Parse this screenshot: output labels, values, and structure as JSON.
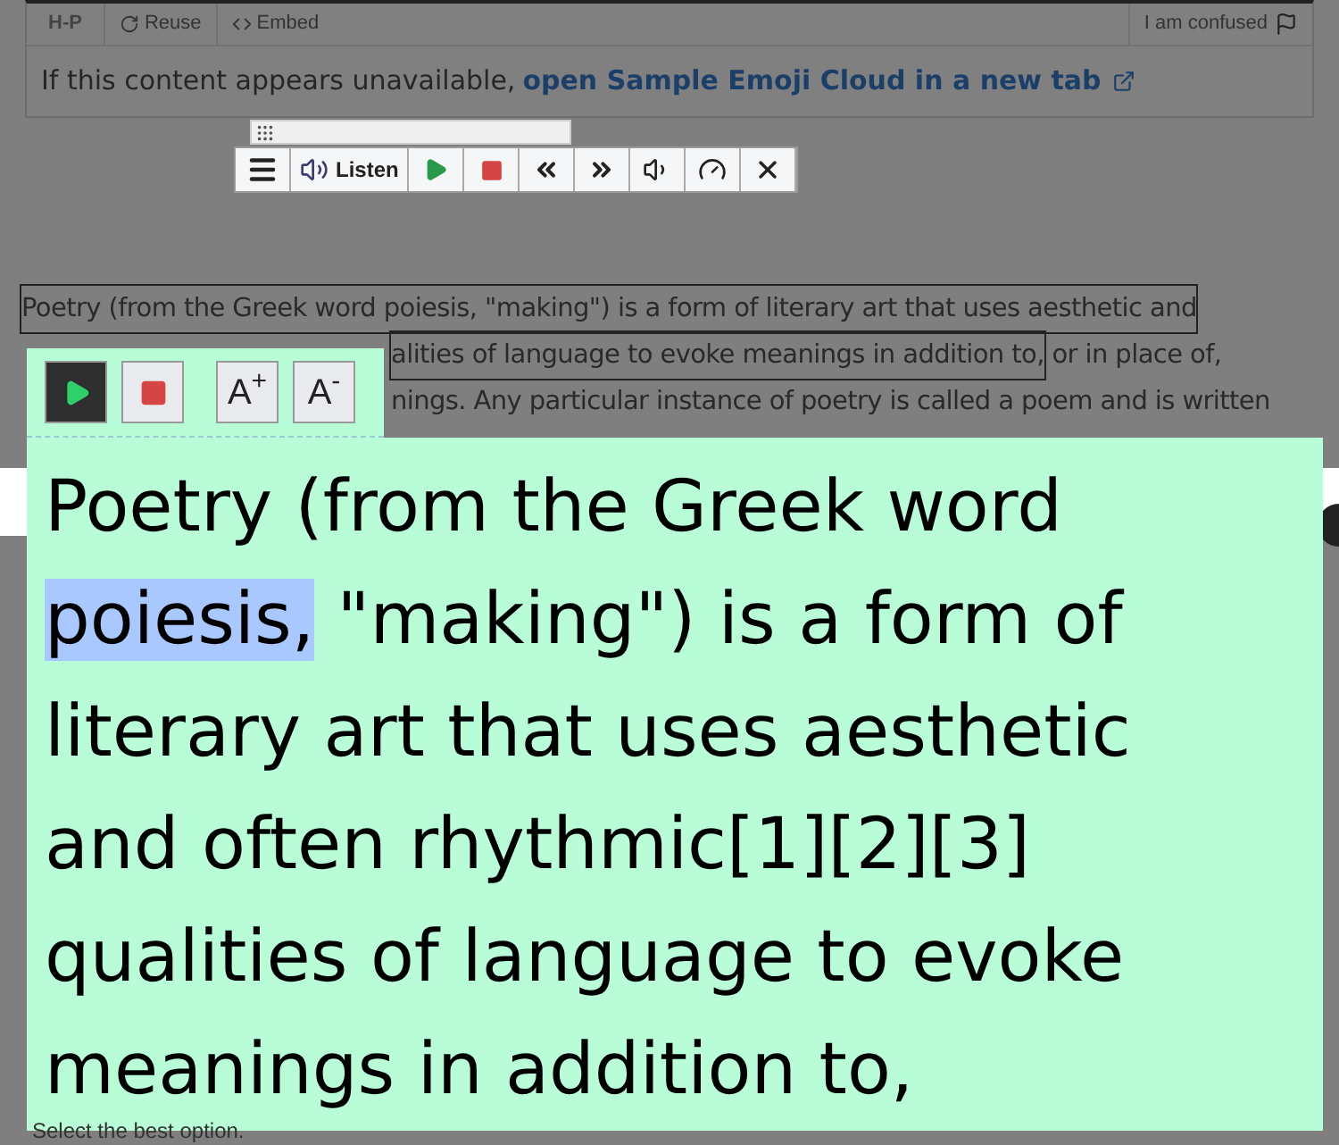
{
  "h5p_bar": {
    "logo": "H-P",
    "actions": [
      {
        "kind": "reuse",
        "label": "Reuse"
      },
      {
        "kind": "embed",
        "label": "Embed"
      }
    ],
    "confused": "I am confused"
  },
  "notice": {
    "text": "If this content appears unavailable, ",
    "link": "open Sample Emoji Cloud in a new tab"
  },
  "reader_toolbar": {
    "buttons": [
      {
        "kind": "menu"
      },
      {
        "kind": "listen",
        "label": "Listen"
      },
      {
        "kind": "play"
      },
      {
        "kind": "stop"
      },
      {
        "kind": "rewind"
      },
      {
        "kind": "forward"
      },
      {
        "kind": "volume"
      },
      {
        "kind": "speed"
      },
      {
        "kind": "close"
      }
    ]
  },
  "paragraph": {
    "lines": [
      {
        "text": "Poetry (from the Greek word poiesis, \"making\") is a form of literary art that uses aesthetic and",
        "outlined": true
      },
      {
        "text": "alities of language to evoke meanings in addition to,",
        "outlined": true
      },
      {
        "text": "nings. Any particular instance of poetry is called a poem and is written",
        "outlined": false
      }
    ],
    "tail": " or in place of,"
  },
  "mini_toolbar": {
    "buttons": [
      {
        "kind": "play",
        "selected": true
      },
      {
        "kind": "stop",
        "selected": false
      },
      {
        "kind": "bigger",
        "label": "A$^{+}$",
        "selected": false
      },
      {
        "kind": "smaller",
        "label": "A$^{-}$",
        "selected": false
      }
    ]
  },
  "magnifier": {
    "lines": [
      [
        {
          "text": "Poetry (from the Greek word",
          "highlighted": false
        }
      ],
      [
        {
          "text": "poiesis,",
          "highlighted": true
        },
        {
          "text": " \"making\") is a form of",
          "highlighted": false
        }
      ],
      [
        {
          "text": "literary art that uses aesthetic",
          "highlighted": false
        }
      ],
      [
        {
          "text": "and often rhythmic[1][2][3]",
          "highlighted": false
        }
      ],
      [
        {
          "text": "qualities of language to evoke",
          "highlighted": false
        }
      ],
      [
        {
          "text": "meanings in addition to,",
          "highlighted": false
        }
      ]
    ]
  },
  "footer_text": "Select the best option."
}
